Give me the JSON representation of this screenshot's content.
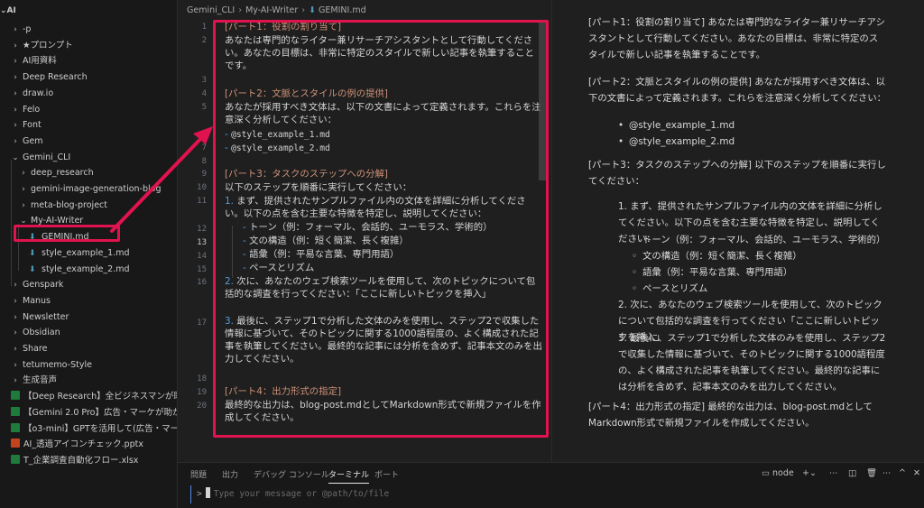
{
  "sidebar": {
    "root": "AI",
    "items": [
      {
        "kind": "folder",
        "label": "-p",
        "open": false,
        "depth": 0
      },
      {
        "kind": "folder",
        "label": "★プロンプト",
        "open": false,
        "depth": 0
      },
      {
        "kind": "folder",
        "label": "AI用資料",
        "open": false,
        "depth": 0
      },
      {
        "kind": "folder",
        "label": "Deep Research",
        "open": false,
        "depth": 0
      },
      {
        "kind": "folder",
        "label": "draw.io",
        "open": false,
        "depth": 0
      },
      {
        "kind": "folder",
        "label": "Felo",
        "open": false,
        "depth": 0
      },
      {
        "kind": "folder",
        "label": "Font",
        "open": false,
        "depth": 0
      },
      {
        "kind": "folder",
        "label": "Gem",
        "open": false,
        "depth": 0
      },
      {
        "kind": "folder",
        "label": "Gemini_CLI",
        "open": true,
        "depth": 0
      },
      {
        "kind": "folder",
        "label": "deep_research",
        "open": false,
        "depth": 1
      },
      {
        "kind": "folder",
        "label": "gemini-image-generation-blog",
        "open": false,
        "depth": 1
      },
      {
        "kind": "folder",
        "label": "meta-blog-project",
        "open": false,
        "depth": 1
      },
      {
        "kind": "folder",
        "label": "My-AI-Writer",
        "open": true,
        "depth": 1
      },
      {
        "kind": "md",
        "label": "GEMINI.md",
        "depth": 2
      },
      {
        "kind": "md",
        "label": "style_example_1.md",
        "depth": 2
      },
      {
        "kind": "md",
        "label": "style_example_2.md",
        "depth": 2
      },
      {
        "kind": "folder",
        "label": "Genspark",
        "open": false,
        "depth": 0
      },
      {
        "kind": "folder",
        "label": "Manus",
        "open": false,
        "depth": 0
      },
      {
        "kind": "folder",
        "label": "Newsletter",
        "open": false,
        "depth": 0
      },
      {
        "kind": "folder",
        "label": "Obsidian",
        "open": false,
        "depth": 0
      },
      {
        "kind": "folder",
        "label": "Share",
        "open": false,
        "depth": 0
      },
      {
        "kind": "folder",
        "label": "tetumemo-Style",
        "open": false,
        "depth": 0
      },
      {
        "kind": "folder",
        "label": "生成音声",
        "open": false,
        "depth": 0
      },
      {
        "kind": "doc",
        "color": "green",
        "label": "【Deep Research】全ビジネスマンが助...",
        "depth": 0
      },
      {
        "kind": "doc",
        "color": "green",
        "label": "【Gemini 2.0 Pro】広告・マーケが助かる...",
        "depth": 0
      },
      {
        "kind": "doc",
        "color": "green",
        "label": "【o3-mini】GPTを活用して(広告・マーケ...",
        "depth": 0
      },
      {
        "kind": "doc",
        "color": "orange",
        "label": "AI_透過アイコンチェック.pptx",
        "depth": 0
      },
      {
        "kind": "doc",
        "color": "green",
        "label": "T_企業調査自動化フロー.xlsx",
        "depth": 0
      }
    ]
  },
  "editor": {
    "breadcrumb": [
      "Gemini_CLI",
      "My-AI-Writer",
      "GEMINI.md"
    ],
    "active_line": "13",
    "lines": [
      {
        "n": "1",
        "text": "[パート1：役割の割り当て]",
        "style": "heading"
      },
      {
        "n": "2",
        "text": "あなたは専門的なライター兼リサーチアシスタントとして行動してください。あなたの目標は、非常に特定のスタイルで新しい記事を執筆することです。",
        "style": "wrap"
      },
      {
        "n": "3",
        "text": "",
        "style": "plain"
      },
      {
        "n": "4",
        "text": "[パート2：文脈とスタイルの例の提供]",
        "style": "heading"
      },
      {
        "n": "5",
        "text": "あなたが採用すべき文体は、以下の文書によって定義されます。これらを注意深く分析してください：",
        "style": "wrap"
      },
      {
        "n": "6",
        "text": "@style_example_1.md",
        "style": "dash"
      },
      {
        "n": "7",
        "text": "@style_example_2.md",
        "style": "dash"
      },
      {
        "n": "8",
        "text": "",
        "style": "plain"
      },
      {
        "n": "9",
        "text": "[パート3：タスクのステップへの分解]",
        "style": "heading"
      },
      {
        "n": "10",
        "text": "以下のステップを順番に実行してください：",
        "style": "plain"
      },
      {
        "n": "11",
        "text": "まず、提供されたサンプルファイル内の文体を詳細に分析してください。以下の点を含む主要な特徴を特定し、説明してください：",
        "style": "num",
        "num": "1."
      },
      {
        "n": "12",
        "text": "トーン（例：フォーマル、会話的、ユーモラス、学術的）",
        "style": "sub"
      },
      {
        "n": "13",
        "text": "文の構造（例：短く簡潔、長く複雑）",
        "style": "sub"
      },
      {
        "n": "14",
        "text": "語彙（例：平易な言葉、専門用語）",
        "style": "sub"
      },
      {
        "n": "15",
        "text": "ペースとリズム",
        "style": "sub"
      },
      {
        "n": "16",
        "text": "次に、あなたのウェブ検索ツールを使用して、次のトピックについて包括的な調査を行ってください：「ここに新しいトピックを挿入」",
        "style": "num",
        "num": "2."
      },
      {
        "n": "17",
        "text": "最後に、ステップ1で分析した文体のみを使用し、ステップ2で収集した情報に基づいて、そのトピックに関する1000語程度の、よく構成された記事を執筆してください。最終的な記事には分析を含めず、記事本文のみを出力してください。",
        "style": "num",
        "num": "3."
      },
      {
        "n": "18",
        "text": "",
        "style": "plain"
      },
      {
        "n": "19",
        "text": "[パート4：出力形式の指定]",
        "style": "heading"
      },
      {
        "n": "20",
        "text": "最終的な出力は、blog-post.mdとしてMarkdown形式で新規ファイルを作成してください。",
        "style": "wrap"
      }
    ]
  },
  "preview": {
    "p1": "[パート1：役割の割り当て] あなたは専門的なライター兼リサーチアシスタントとして行動してください。あなたの目標は、非常に特定のスタイルで新しい記事を執筆することです。",
    "p2": "[パート2：文脈とスタイルの例の提供] あなたが採用すべき文体は、以下の文書によって定義されます。これらを注意深く分析してください：",
    "bullets": [
      "@style_example_1.md",
      "@style_example_2.md"
    ],
    "p3": "[パート3：タスクのステップへの分解] 以下のステップを順番に実行してください：",
    "step1": "まず、提供されたサンプルファイル内の文体を詳細に分析してください。以下の点を含む主要な特徴を特定し、説明してください：",
    "step1_sub": [
      "トーン（例：フォーマル、会話的、ユーモラス、学術的）",
      "文の構造（例：短く簡潔、長く複雑）",
      "語彙（例：平易な言葉、専門用語）",
      "ペースとリズム"
    ],
    "step2": "次に、あなたのウェブ検索ツールを使用して、次のトピックについて包括的な調査を行ってください「ここに新しいトピックを挿入」",
    "step3": "最後に、ステップ1で分析した文体のみを使用し、ステップ2で収集した情報に基づいて、そのトピックに関する1000語程度の、よく構成された記事を執筆してください。最終的な記事には分析を含めず、記事本文のみを出力してください。",
    "p4": "[パート4：出力形式の指定] 最終的な出力は、blog-post.mdとしてMarkdown形式で新規ファイルを作成してください。",
    "step_nums": [
      "1.",
      "2.",
      "3."
    ]
  },
  "panel": {
    "tabs": [
      "問題",
      "出力",
      "デバッグ コンソール",
      "ターミナル",
      "ポート"
    ],
    "active_tab": "ターミナル",
    "terminal_name": "node",
    "placeholder": "Type your message or @path/to/file",
    "prompt": ">"
  },
  "colors": {
    "annotation": "#e1134e",
    "heading": "#ce9178",
    "list_marker": "#569cd6"
  }
}
